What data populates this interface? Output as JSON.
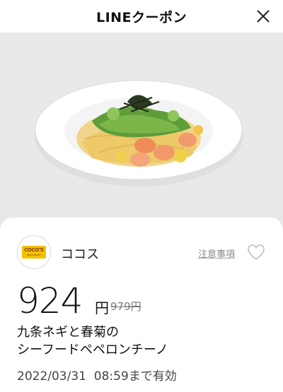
{
  "header": {
    "title": "LINEクーポン",
    "close_icon": "close-icon"
  },
  "hero": {
    "alt": "pasta-dish"
  },
  "store": {
    "logo_text": "COCO'S",
    "logo_subtext": "RESTAURANT",
    "name": "ココス"
  },
  "actions": {
    "notes_label": "注意事項",
    "favorite_icon": "heart-outline-icon"
  },
  "coupon": {
    "price": "924",
    "price_unit": "円",
    "original_price": "979円",
    "product_line1": "九条ネギと春菊の",
    "product_line2": "シーフードペペロンチーノ",
    "validity": "2022/03/31  08:59まで有効"
  },
  "colors": {
    "logo_yellow": "#f2c200",
    "background": "#e9e9e9"
  }
}
